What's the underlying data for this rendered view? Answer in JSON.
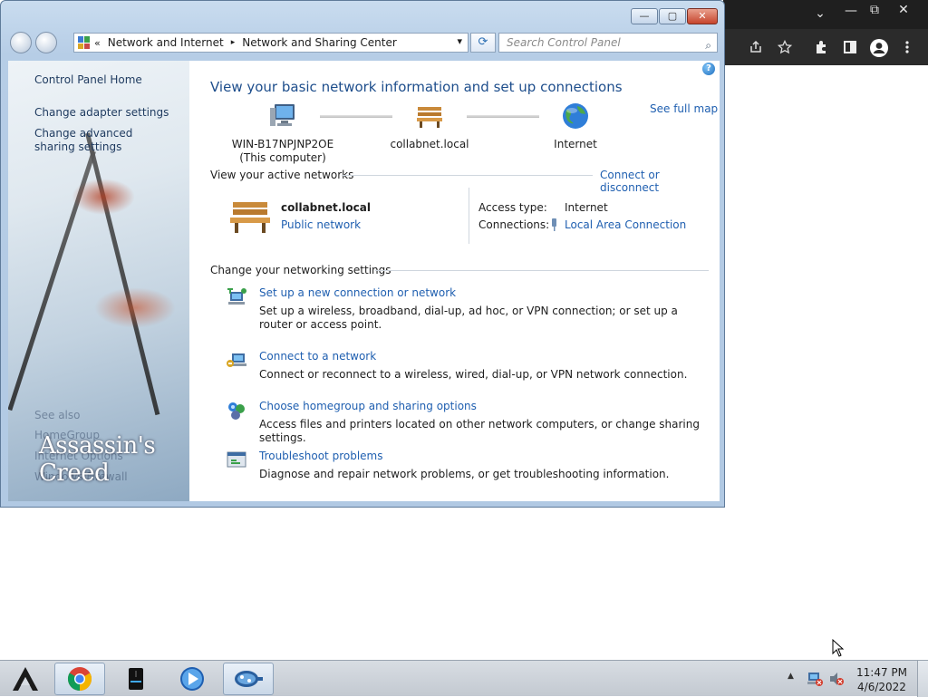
{
  "window": {
    "caption_buttons": {
      "minimize": "—",
      "maximize": "▢",
      "close": "✕"
    },
    "address_bar": {
      "overflow": "«",
      "crumbs": [
        "Network and Internet",
        "Network and Sharing Center"
      ],
      "separator": "▸",
      "dropdown": "▾",
      "refresh": "⟳"
    },
    "search": {
      "placeholder": "Search Control Panel",
      "icon": "⌕"
    }
  },
  "sidebar": {
    "items": [
      {
        "label": "Control Panel Home"
      },
      {
        "label": "Change adapter settings"
      },
      {
        "label": "Change advanced sharing settings"
      }
    ],
    "see_also": {
      "title": "See also",
      "items": [
        "HomeGroup",
        "Internet Options",
        "Windows Firewall"
      ]
    },
    "wallpaper_text": "Assassin's Creed"
  },
  "main": {
    "help": "?",
    "heading": "View your basic network information and set up connections",
    "see_full_map": "See full map",
    "map": {
      "computer": {
        "name": "WIN-B17NPJNP2OE",
        "sub": "(This computer)"
      },
      "network": {
        "name": "collabnet.local"
      },
      "internet": {
        "name": "Internet"
      }
    },
    "active_networks": {
      "title": "View your active networks",
      "connect_link": "Connect or disconnect",
      "name": "collabnet.local",
      "type": "Public network",
      "access_type_label": "Access type:",
      "access_type_value": "Internet",
      "connections_label": "Connections:",
      "connections_value": "Local Area Connection"
    },
    "settings": {
      "title": "Change your networking settings",
      "tasks": [
        {
          "title": "Set up a new connection or network",
          "desc": "Set up a wireless, broadband, dial-up, ad hoc, or VPN connection; or set up a router or access point.",
          "icon": "new-connection-icon"
        },
        {
          "title": "Connect to a network",
          "desc": "Connect or reconnect to a wireless, wired, dial-up, or VPN network connection.",
          "icon": "connect-network-icon"
        },
        {
          "title": "Choose homegroup and sharing options",
          "desc": "Access files and printers located on other network computers, or change sharing settings.",
          "icon": "homegroup-icon"
        },
        {
          "title": "Troubleshoot problems",
          "desc": "Diagnose and repair network problems, or get troubleshooting information.",
          "icon": "troubleshoot-icon"
        }
      ]
    }
  },
  "chrome_bg": {
    "controls": {
      "dropdown": "⌄",
      "minimize": "—",
      "restore": "⧉",
      "close": "✕"
    },
    "toolbar_icons": [
      "share-icon",
      "star-icon",
      "extensions-icon",
      "sidepanel-icon",
      "profile-icon",
      "menu-icon"
    ]
  },
  "taskbar": {
    "apps": [
      "assassins-creed-icon",
      "chrome-icon",
      "file-manager-icon",
      "media-player-icon",
      "network-center-icon"
    ],
    "tray": {
      "chevron": "▲"
    },
    "clock": {
      "time": "11:47 PM",
      "date": "4/6/2022"
    }
  }
}
